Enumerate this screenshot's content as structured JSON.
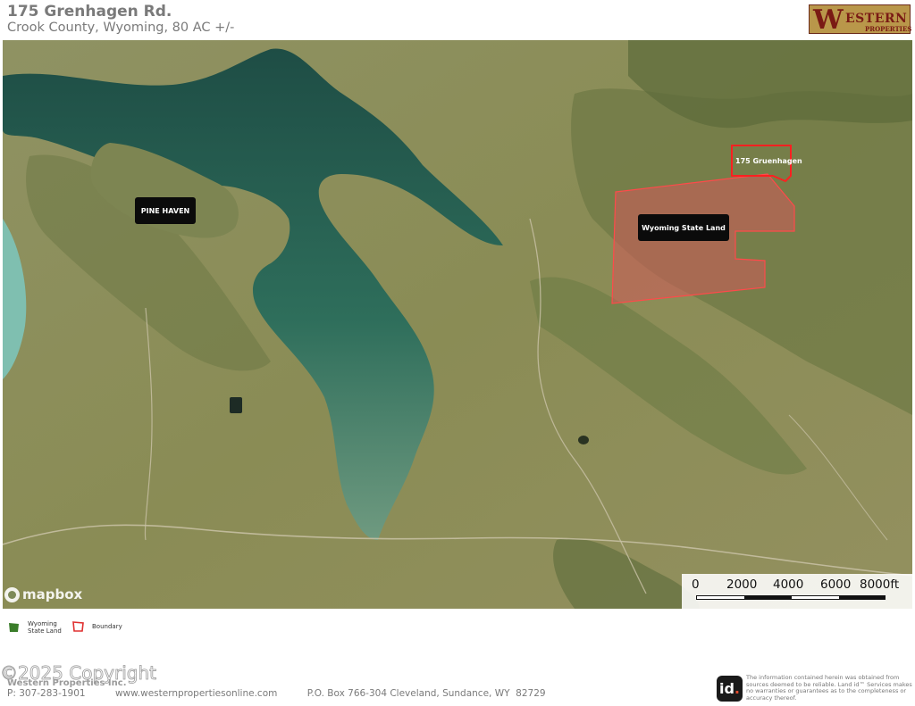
{
  "header": {
    "title": "175 Grenhagen Rd.",
    "subtitle": "Crook County, Wyoming, 80 AC +/-"
  },
  "logo": {
    "letter": "W",
    "name": "ESTERN",
    "tagline": "PROPERTIES"
  },
  "map": {
    "labels": {
      "town": "PINE HAVEN",
      "state_land": "Wyoming State Land",
      "property": "175 Gruenhagen"
    },
    "attribution": "mapbox",
    "scale": {
      "ticks": [
        "0",
        "2000",
        "4000",
        "6000",
        "8000ft"
      ]
    },
    "colors": {
      "reservoir": "#2d6b58",
      "grassland": "#8a8d55",
      "state_land_fill": "#d25a5a",
      "boundary": "#ff2b2b"
    }
  },
  "legend": {
    "state_land": "Wyoming\nState Land",
    "boundary": "Boundary",
    "state_land_color": "#3a7d2a",
    "boundary_color": "#e03030"
  },
  "footer": {
    "copyright": "©2025 Copyright",
    "company": "Western Properties Inc.",
    "contact": "P: 307-283-1901          www.westernpropertiesonline.com          P.O. Box 766-304 Cleveland, Sundance, WY  82729",
    "id_logo": "id",
    "disclaimer": "The information contained herein was obtained from sources deemed to be reliable. Land id™ Services makes no warranties or guarantees as to the completeness or accuracy thereof."
  }
}
